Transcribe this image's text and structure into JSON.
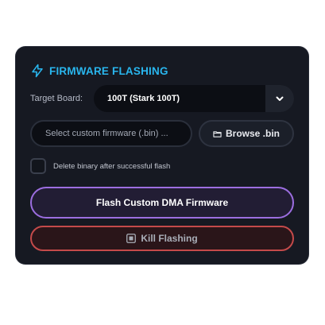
{
  "header": {
    "icon": "lightning-icon",
    "title": "FIRMWARE FLASHING",
    "accent_color": "#29b6ee"
  },
  "board": {
    "label": "Target Board:",
    "selected": "100T (Stark 100T)",
    "dropdown_icon": "chevron-down-icon"
  },
  "firmware": {
    "placeholder": "Select custom firmware (.bin) ..."
  },
  "browse": {
    "icon": "folder-icon",
    "label": "Browse .bin"
  },
  "delete_option": {
    "label": "Delete binary after successful flash",
    "checked": false
  },
  "flash_button": {
    "label": "Flash Custom DMA Firmware",
    "border_color": "#9c6ee0"
  },
  "kill_button": {
    "icon": "stop-icon",
    "label": "Kill Flashing",
    "border_color": "#c44a4a"
  }
}
